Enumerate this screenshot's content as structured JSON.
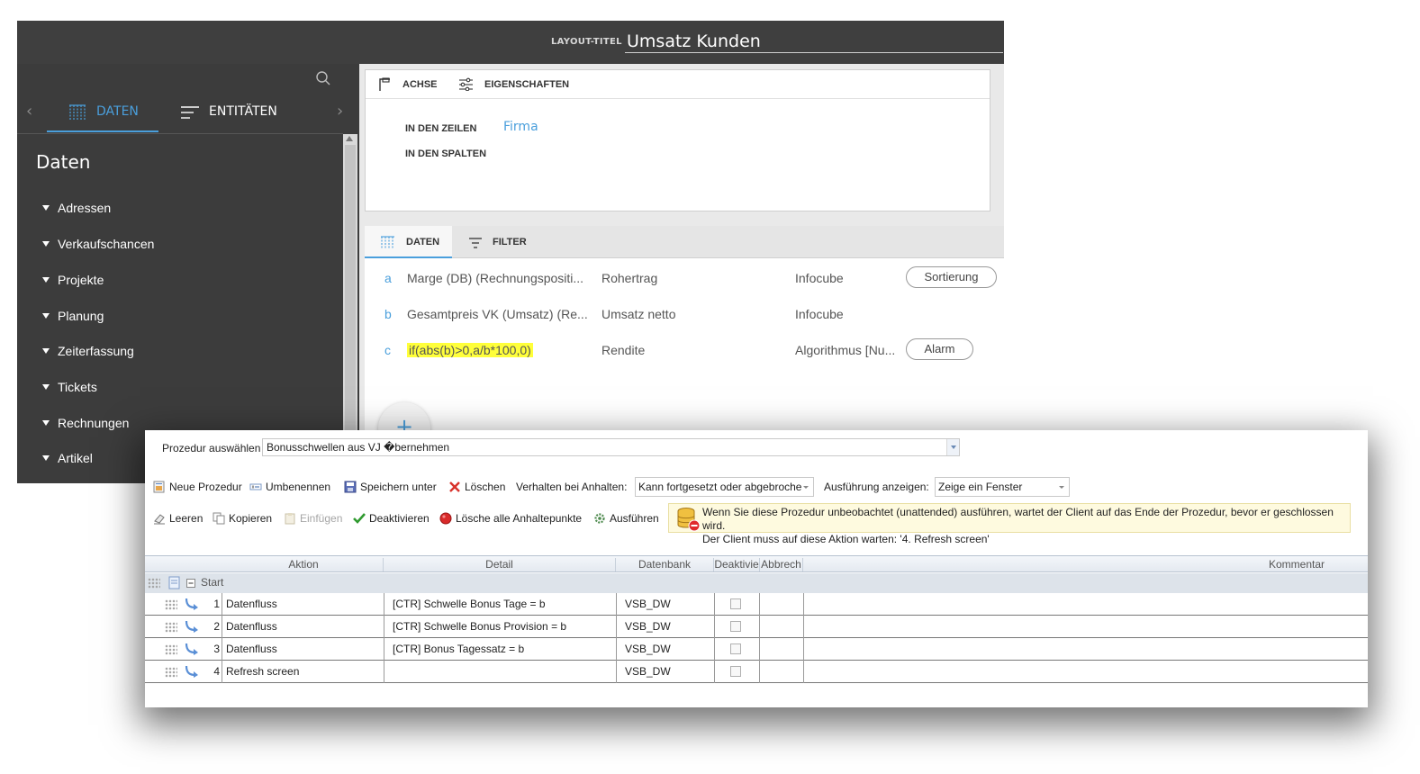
{
  "header": {
    "layout_title_label": "LAYOUT-TITEL",
    "layout_title": "Umsatz Kunden"
  },
  "left_panel": {
    "tabs": [
      {
        "label": "DATEN"
      },
      {
        "label": "ENTITÄTEN"
      }
    ],
    "heading": "Daten",
    "items": [
      {
        "label": "Adressen"
      },
      {
        "label": "Verkaufschancen"
      },
      {
        "label": "Projekte"
      },
      {
        "label": "Planung"
      },
      {
        "label": "Zeiterfassung"
      },
      {
        "label": "Tickets"
      },
      {
        "label": "Rechnungen"
      },
      {
        "label": "Artikel"
      }
    ]
  },
  "axis_panel": {
    "tabs": [
      {
        "label": "ACHSE"
      },
      {
        "label": "EIGENSCHAFTEN"
      }
    ],
    "rows_label": "IN DEN ZEILEN",
    "rows_value": "Firma",
    "columns_label": "IN DEN SPALTEN"
  },
  "data_panel": {
    "tabs": [
      {
        "label": "DATEN"
      },
      {
        "label": "FILTER"
      }
    ],
    "rows": [
      {
        "letter": "a",
        "formula": "Marge (DB) (Rechnungspositi...",
        "name": "Rohertrag",
        "source": "Infocube",
        "button": "Sortierung"
      },
      {
        "letter": "b",
        "formula": "Gesamtpreis VK (Umsatz) (Re...",
        "name": "Umsatz netto",
        "source": "Infocube",
        "button": ""
      },
      {
        "letter": "c",
        "formula": "if(abs(b)>0,a/b*100,0)",
        "name": "Rendite",
        "source": "Algorithmus [Nu...",
        "button": "Alarm"
      }
    ],
    "add_label": "+"
  },
  "dialog": {
    "procedure_label": "Prozedur auswählen",
    "procedure_value": "Bonusschwellen aus VJ �bernehmen",
    "toolbar1": {
      "new": "Neue Prozedur",
      "rename": "Umbenennen",
      "save_as": "Speichern unter",
      "delete": "Löschen",
      "halt_label": "Verhalten bei Anhalten:",
      "halt_value": "Kann fortgesetzt oder abgebroche",
      "display_label": "Ausführung anzeigen:",
      "display_value": "Zeige ein Fenster"
    },
    "toolbar2": {
      "clear": "Leeren",
      "copy": "Kopieren",
      "paste": "Einfügen",
      "deactivate": "Deaktivieren",
      "clear_breakpoints": "Lösche alle Anhaltepunkte",
      "run": "Ausführen"
    },
    "info_lines": [
      "Wenn Sie diese Prozedur unbeobachtet (unattended) ausführen, wartet der Client auf das Ende der Prozedur, bevor er geschlossen wird.",
      "Der Client muss auf diese Aktion warten: '4. Refresh screen'"
    ],
    "grid": {
      "columns": [
        "Aktion",
        "Detail",
        "Datenbank",
        "Deaktivie",
        "Abbrech",
        "Kommentar"
      ],
      "start_label": "Start",
      "rows": [
        {
          "num": "1",
          "action": "Datenfluss",
          "detail": "[CTR] Schwelle Bonus Tage = b",
          "db": "VSB_DW"
        },
        {
          "num": "2",
          "action": "Datenfluss",
          "detail": "[CTR] Schwelle Bonus Provision = b",
          "db": "VSB_DW"
        },
        {
          "num": "3",
          "action": "Datenfluss",
          "detail": "[CTR] Bonus Tagessatz = b",
          "db": "VSB_DW"
        },
        {
          "num": "4",
          "action": "Refresh screen",
          "detail": "",
          "db": "VSB_DW"
        }
      ]
    }
  },
  "colors": {
    "accent": "#4a9fdc",
    "dark_bg": "#3c3c3c",
    "highlight": "#ffff3a"
  }
}
